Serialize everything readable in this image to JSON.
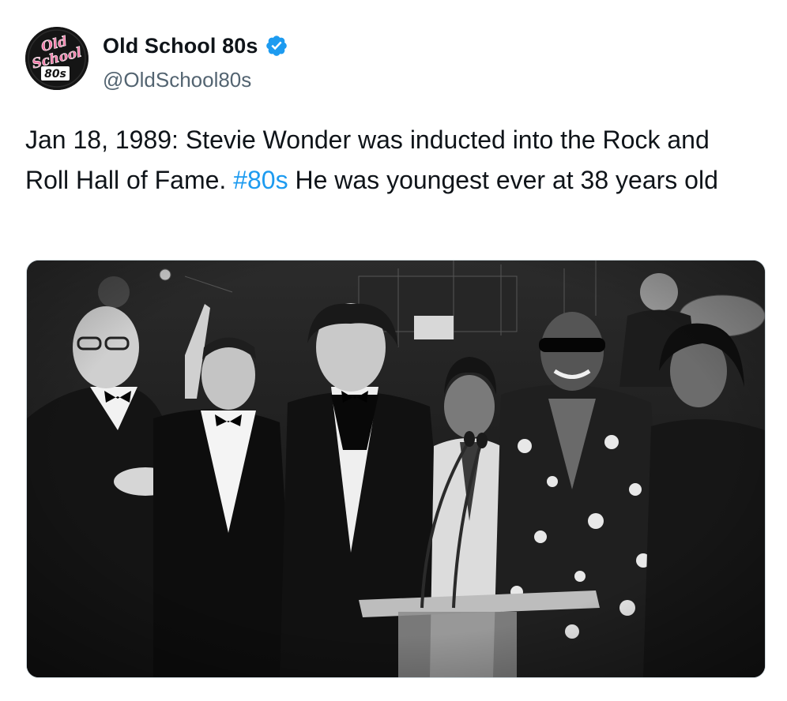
{
  "author": {
    "display_name": "Old School 80s",
    "handle": "@OldSchool80s",
    "verified": true,
    "avatar_logo_text": [
      "Old",
      "School",
      "80s"
    ],
    "avatar_icon": "old-school-80s-logo",
    "verified_icon": "verified-badge-icon"
  },
  "tweet": {
    "text_before": "Jan 18, 1989: Stevie Wonder was inducted into the Rock and Roll Hall of Fame. ",
    "hashtag": "#80s",
    "text_after": " He was youngest ever at 38 years old"
  },
  "media": {
    "kind": "black-and-white photo",
    "subject": "group-photo"
  },
  "colors": {
    "text": "#0f1419",
    "secondary_text": "#536471",
    "link": "#1d9bf0",
    "verified": "#1d9bf0",
    "border": "#cfd9de",
    "logo_pink": "#f27aa8"
  }
}
